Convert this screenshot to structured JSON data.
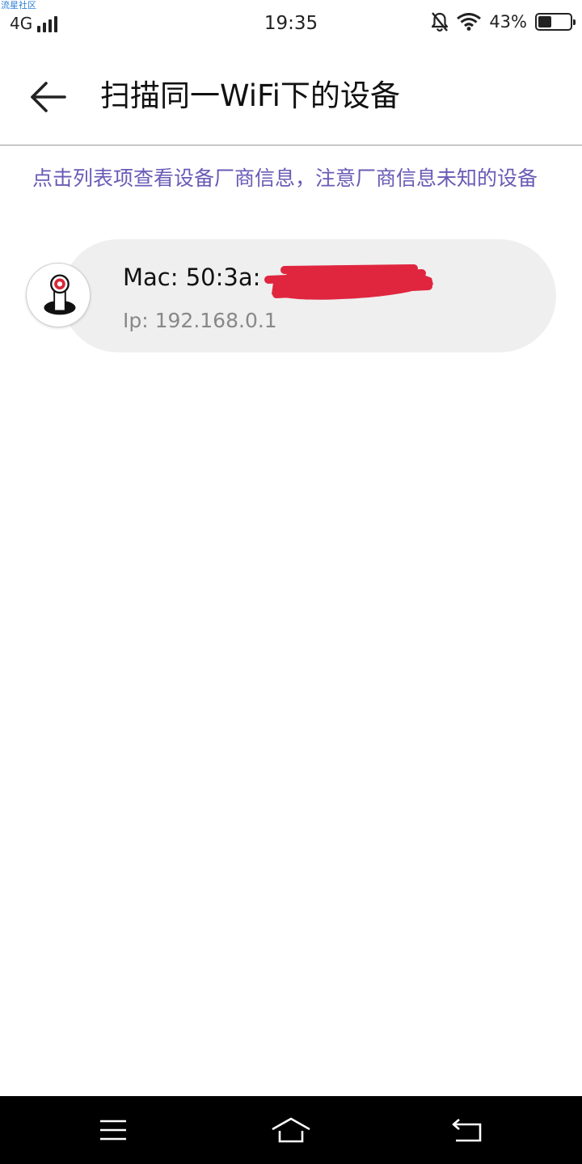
{
  "watermark": "流星社区",
  "status_bar": {
    "network": "4G",
    "signal_icon": "signal-bars-icon",
    "time": "19:35",
    "silent_icon": "bell-off-icon",
    "wifi_icon": "wifi-icon",
    "battery_percent": "43%",
    "battery_level": 0.43
  },
  "app_bar": {
    "back_icon": "arrow-left-icon",
    "title": "扫描同一WiFi下的设备"
  },
  "hint": "点击列表项查看设备厂商信息，注意厂商信息未知的设备",
  "devices": [
    {
      "icon": "camera-device-icon",
      "mac": "Mac: 50:3a:",
      "ip": "Ip: 192.168.0.1"
    }
  ],
  "colors": {
    "hint_text": "#6a5ab6",
    "item_background": "#efefef",
    "redaction": "#e0263f",
    "nav_bar": "#000000"
  },
  "nav_bar": {
    "menu_icon": "menu-icon",
    "home_icon": "home-icon",
    "back_icon": "back-return-icon"
  }
}
